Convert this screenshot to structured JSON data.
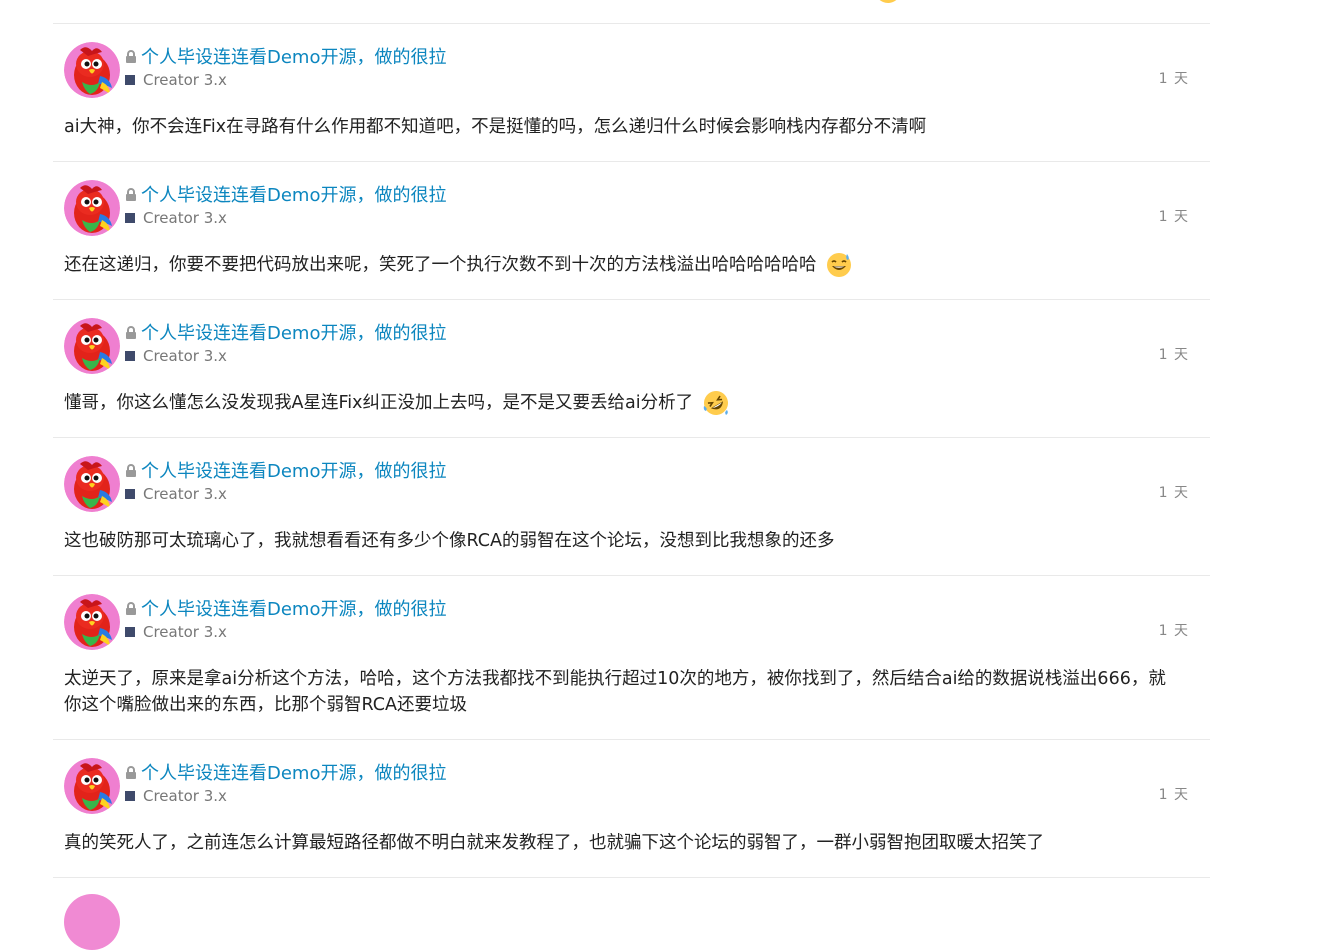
{
  "thread": {
    "posts": [
      {
        "topic": "个人毕设连连看Demo开源，做的很拉",
        "category": "Creator 3.x",
        "age": "1 天",
        "body": "ai大神，你不会连Fix在寻路有什么作用都不知道吧，不是挺懂的吗，怎么递归什么时候会影响栈内存都分不清啊",
        "emoji": ""
      },
      {
        "topic": "个人毕设连连看Demo开源，做的很拉",
        "category": "Creator 3.x",
        "age": "1 天",
        "body": "还在这递归，你要不要把代码放出来呢，笑死了一个执行次数不到十次的方法栈溢出哈哈哈哈哈哈",
        "emoji": "sweat-smile-emoji"
      },
      {
        "topic": "个人毕设连连看Demo开源，做的很拉",
        "category": "Creator 3.x",
        "age": "1 天",
        "body": "懂哥，你这么懂怎么没发现我A星连Fix纠正没加上去吗，是不是又要丢给ai分析了",
        "emoji": "rofl-emoji"
      },
      {
        "topic": "个人毕设连连看Demo开源，做的很拉",
        "category": "Creator 3.x",
        "age": "1 天",
        "body": "这也破防那可太琉璃心了，我就想看看还有多少个像RCA的弱智在这个论坛，没想到比我想象的还多",
        "emoji": ""
      },
      {
        "topic": "个人毕设连连看Demo开源，做的很拉",
        "category": "Creator 3.x",
        "age": "1 天",
        "body": "太逆天了，原来是拿ai分析这个方法，哈哈，这个方法我都找不到能执行超过10次的地方，被你找到了，然后结合ai给的数据说栈溢出666，就你这个嘴脸做出来的东西，比那个弱智RCA还要垃圾",
        "emoji": ""
      },
      {
        "topic": "个人毕设连连看Demo开源，做的很拉",
        "category": "Creator 3.x",
        "age": "1 天",
        "body": "真的笑死人了，之前连怎么计算最短路径都做不明白就来发教程了，也就骗下这个论坛的弱智了，一群小弱智抱团取暖太招笑了",
        "emoji": ""
      }
    ]
  },
  "colors": {
    "link": "#0c86bf",
    "category_square": "#3f4a6b",
    "muted": "#888888",
    "divider": "#e9e9e9"
  }
}
